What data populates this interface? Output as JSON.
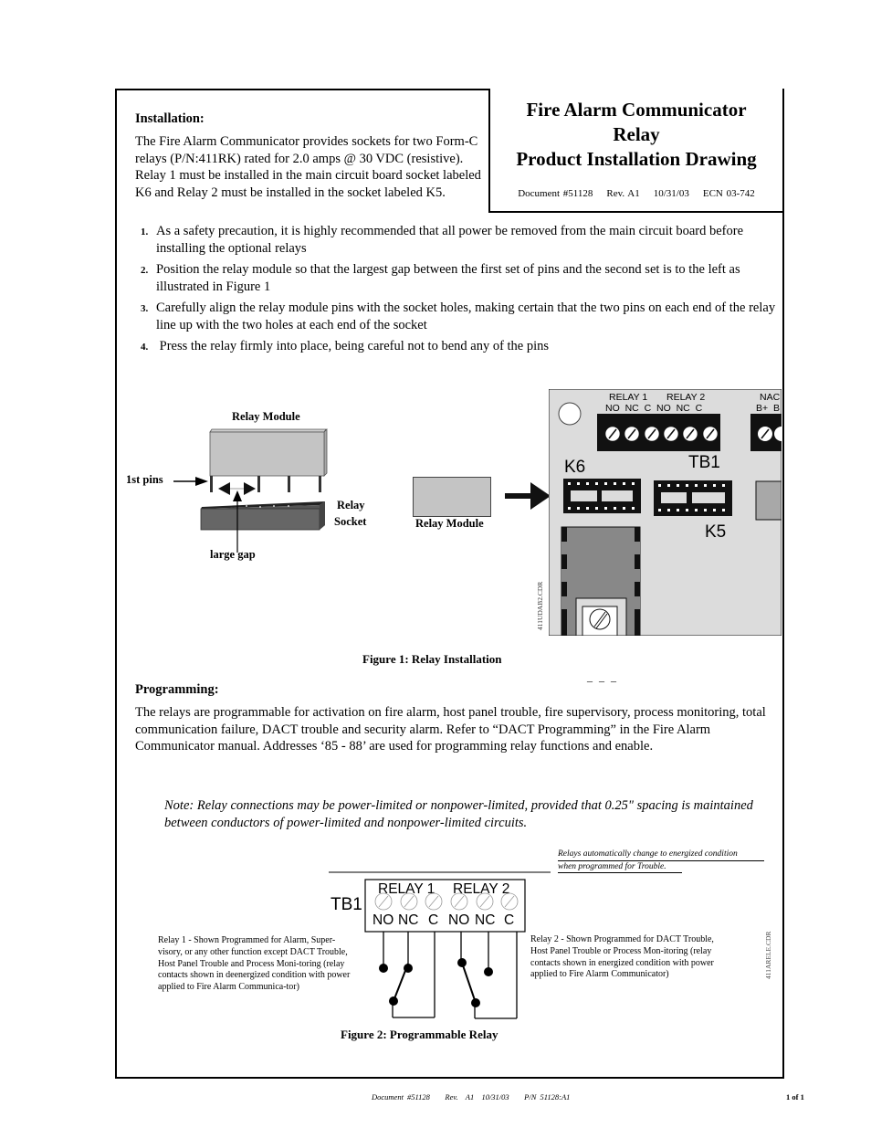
{
  "title_block": {
    "line1": "Fire Alarm Communicator",
    "line2": "Relay",
    "line3": "Product Installation Drawing",
    "document": "Document #51128    Rev. A1    10/31/03    ECN 03-742"
  },
  "installation": {
    "heading": "Installation:",
    "intro": "The Fire Alarm Communicator provides sockets for two Form-C relays (P/N:411RK) rated for 2.0 amps @ 30 VDC (resistive).  Relay 1 must be installed in the main circuit board socket labeled K6 and Relay 2 must be installed in the socket labeled K5.",
    "steps": [
      {
        "num": "1.",
        "text": "As a safety precaution, it is highly recommended that all power be removed from the main circuit board before installing the optional relays"
      },
      {
        "num": "2.",
        "text": "Position the relay module so that the largest gap between the first set of pins and the second set is to the left as illustrated in Figure 1"
      },
      {
        "num": "3.",
        "text": "Carefully align the relay module pins with the socket holes, making certain that the two pins on each end of the relay line up with the two holes at each end of the socket"
      },
      {
        "num": "4.",
        "text": " Press the relay firmly into place, being careful not to bend any of the pins"
      }
    ]
  },
  "figure1": {
    "relay_module_label": "Relay Module",
    "first_pins_label": "1st pins",
    "relay_socket_label_1": "Relay",
    "relay_socket_label_2": "Socket",
    "large_gap_label": "large gap",
    "relay_module_label_2": "Relay Module",
    "board": {
      "relay1": "RELAY 1",
      "relay2": "RELAY 2",
      "terminals": "NO  NC  C  NO  NC  C",
      "nac": "NAC",
      "nac_terms": "B+  B",
      "tb1": "TB1",
      "k6": "K6",
      "k5": "K5"
    },
    "file_id": "411UDAB2.CDR",
    "caption": "Figure 1: Relay Installation",
    "dashes": "_ _ _"
  },
  "programming": {
    "heading": "Programming:",
    "text": "The relays are programmable for activation on fire alarm, host panel trouble, fire supervisory, process monitoring, total communication failure, DACT trouble and security alarm.  Refer to “DACT Programming” in the Fire Alarm Communicator manual.  Addresses ‘85 - 88’ are used for programming relay functions and enable."
  },
  "note": "Note: Relay connections may be power-limited or nonpower-limited, provided that 0.25\" spacing is maintained between conductors of power-limited and nonpower-limited circuits.",
  "figure2": {
    "trouble_note_1": "Relays automatically change to energized condition",
    "trouble_note_2": "when programmed for Trouble.",
    "tb1": "TB1",
    "relay1": "RELAY 1",
    "relay2": "RELAY 2",
    "terminals": [
      "NO",
      "NC",
      "C",
      "NO",
      "NC",
      "C"
    ],
    "relay1_desc": "Relay 1 - Shown Programmed for Alarm, Super-visory, or any other function except DACT Trouble, Host Panel Trouble and Process Moni-toring (relay contacts shown in deenergized condition with power applied to Fire Alarm Communica-tor)",
    "relay2_desc": "Relay 2 - Shown Programmed for DACT Trouble, Host Panel Trouble or Process Mon-itoring (relay contacts shown in energized condition with power applied to Fire Alarm Communicator)",
    "file_id": "411ARELE.CDR",
    "caption": "Figure 2: Programmable Relay"
  },
  "footer": {
    "document": "Document #51128    Rev.  A1  10/31/03    P/N 51128:A1",
    "page": "1 of 1"
  }
}
